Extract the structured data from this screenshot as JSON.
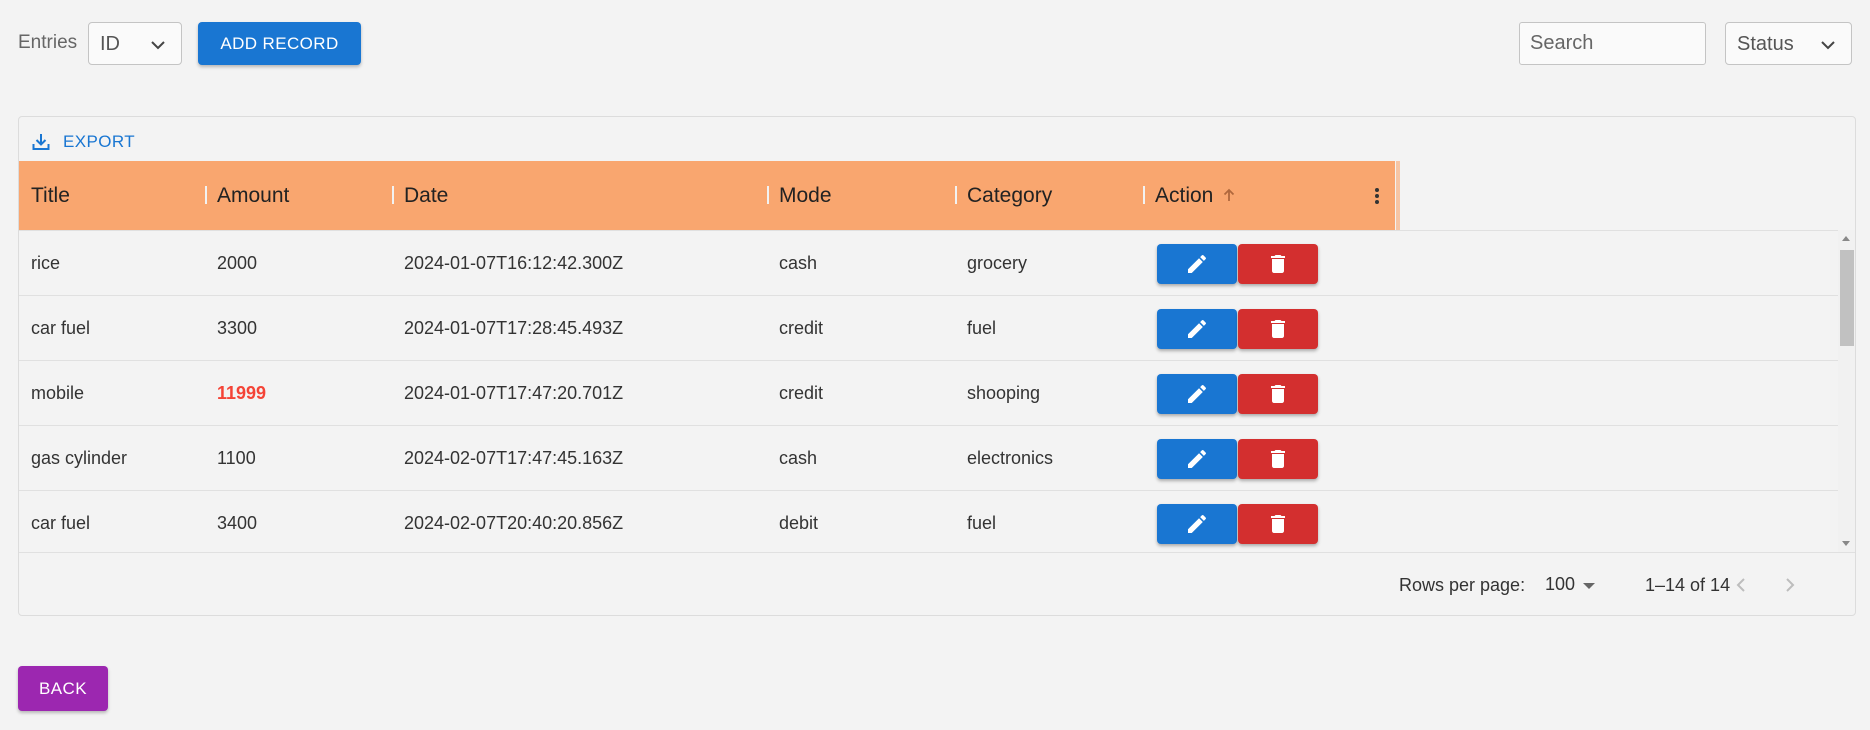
{
  "toolbar": {
    "entries_label": "Entries",
    "entries_value": "ID",
    "add_label": "ADD RECORD",
    "search_placeholder": "Search",
    "status_value": "Status"
  },
  "grid": {
    "export_label": "EXPORT",
    "header_color": "#f9a66f",
    "columns": [
      "Title",
      "Amount",
      "Date",
      "Mode",
      "Category",
      "Action"
    ],
    "sorted_column": "Action",
    "sort_direction": "ascending",
    "rows": [
      {
        "title": "rice",
        "amount": "2000",
        "date": "2024-01-07T16:12:42.300Z",
        "mode": "cash",
        "category": "grocery",
        "highlight": false
      },
      {
        "title": "car fuel",
        "amount": "3300",
        "date": "2024-01-07T17:28:45.493Z",
        "mode": "credit",
        "category": "fuel",
        "highlight": false
      },
      {
        "title": "mobile",
        "amount": "11999",
        "date": "2024-01-07T17:47:20.701Z",
        "mode": "credit",
        "category": "shooping",
        "highlight": true
      },
      {
        "title": "gas cylinder",
        "amount": "1100",
        "date": "2024-02-07T17:47:45.163Z",
        "mode": "cash",
        "category": "electronics",
        "highlight": false
      },
      {
        "title": "car fuel",
        "amount": "3400",
        "date": "2024-02-07T20:40:20.856Z",
        "mode": "debit",
        "category": "fuel",
        "highlight": false
      }
    ],
    "actions": {
      "edit_icon": "pencil-icon",
      "delete_icon": "trash-icon",
      "edit_color": "#1976d2",
      "delete_color": "#d32f2f"
    }
  },
  "footer": {
    "rows_per_page_label": "Rows per page:",
    "rows_per_page_value": "100",
    "range": "1–14 of 14"
  },
  "back_label": "BACK",
  "colors": {
    "primary": "#1976d2",
    "back": "#9c27b0",
    "highlight_amount": "#f44336"
  }
}
